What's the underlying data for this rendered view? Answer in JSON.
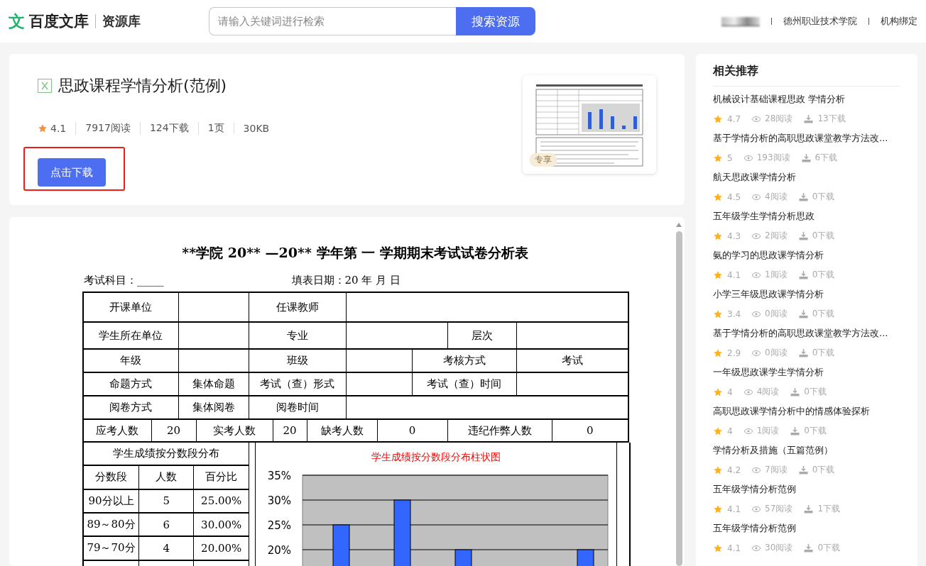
{
  "header": {
    "logo_mark": "文",
    "logo_text": "百度文库",
    "section": "资源库",
    "search": {
      "placeholder": "请输入关键词进行检索",
      "button": "搜索资源"
    },
    "links": [
      "德州职业技术学院",
      "机构绑定"
    ]
  },
  "document": {
    "title": "思政课程学情分析(范例)",
    "rating": "4.1",
    "stats": [
      "7917阅读",
      "124下载",
      "1页",
      "30KB"
    ],
    "download_button": "点击下载",
    "badge": "专享"
  },
  "page": {
    "heading": "**学院 20** —20** 学年第 一 学期期末考试试卷分析表",
    "subject": "考试科目：_____",
    "date": "填表日期：20 年 月 日",
    "form_rows": [
      [
        "开课单位",
        "任课教师"
      ],
      [
        "学生所在单位",
        "专业",
        "层次"
      ],
      [
        "年级",
        "班级",
        "考核方式",
        "考试"
      ],
      [
        "命题方式",
        "集体命题",
        "考试（查）形式",
        "考试（查）时间"
      ],
      [
        "阅卷方式",
        "集体阅卷",
        "阅卷时间"
      ],
      [
        "应考人数",
        "20",
        "实考人数",
        "20",
        "缺考人数",
        "0",
        "违纪作弊人数",
        "0"
      ]
    ],
    "distribution": {
      "title": "学生成绩按分数段分布",
      "columns": [
        "分数段",
        "人数",
        "百分比"
      ],
      "rows": [
        [
          "90分以上",
          "5",
          "25.00%"
        ],
        [
          "89～80分",
          "6",
          "30.00%"
        ],
        [
          "79～70分",
          "4",
          "20.00%"
        ]
      ]
    },
    "chart_data": {
      "type": "bar",
      "grid": true,
      "title": "学生成绩按分数段分布柱状图",
      "values": [
        25,
        30,
        20,
        null,
        20
      ],
      "ylim": [
        0,
        35
      ],
      "yticks": [
        {
          "value": 35,
          "label": "35%"
        },
        {
          "value": 30,
          "label": "30%"
        },
        {
          "value": 25,
          "label": "25%"
        },
        {
          "value": 20,
          "label": "20%"
        }
      ]
    }
  },
  "sidebar": {
    "title": "相关推荐",
    "items": [
      {
        "title": "机械设计基础课程思政 学情分析",
        "rating": "4.7",
        "reads": "28阅读",
        "downloads": "13下载"
      },
      {
        "title": "基于学情分析的高职思政课堂教学方法改...",
        "rating": "5",
        "reads": "193阅读",
        "downloads": "6下载"
      },
      {
        "title": "航天思政课学情分析",
        "rating": "4.5",
        "reads": "4阅读",
        "downloads": "0下载"
      },
      {
        "title": "五年级学生学情分析思政",
        "rating": "4.3",
        "reads": "2阅读",
        "downloads": "0下载"
      },
      {
        "title": "氨的学习的思政课学情分析",
        "rating": "4.1",
        "reads": "1阅读",
        "downloads": "0下载"
      },
      {
        "title": "小学三年级思政课学情分析",
        "rating": "3.4",
        "reads": "0阅读",
        "downloads": "0下载"
      },
      {
        "title": "基于学情分析的高职思政课堂教学方法改...",
        "rating": "2.9",
        "reads": "0阅读",
        "downloads": "0下载"
      },
      {
        "title": "一年级思政课学生学情分析",
        "rating": "4",
        "reads": "4阅读",
        "downloads": "0下载"
      },
      {
        "title": "高职思政课学情分析中的情感体验探析",
        "rating": "4",
        "reads": "1阅读",
        "downloads": "0下载"
      },
      {
        "title": "学情分析及措施（五篇范例）",
        "rating": "4.2",
        "reads": "7阅读",
        "downloads": "0下载"
      },
      {
        "title": "五年级学情分析范例",
        "rating": "4.1",
        "reads": "57阅读",
        "downloads": "1下载"
      },
      {
        "title": "五年级学情分析范例",
        "rating": "4.1",
        "reads": "30阅读",
        "downloads": "0下载"
      }
    ]
  }
}
